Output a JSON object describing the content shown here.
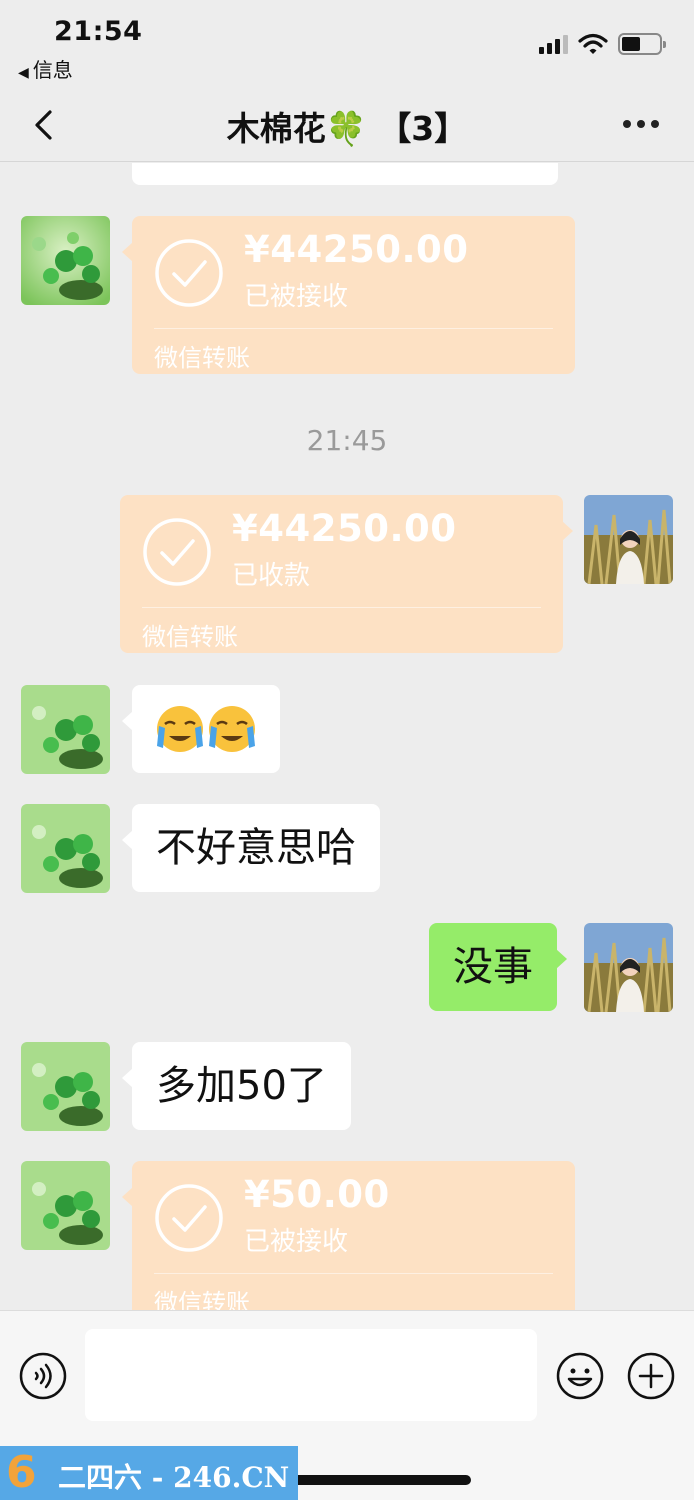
{
  "status_bar": {
    "time": "21:54",
    "back_app": "信息"
  },
  "nav": {
    "title": "木棉花🍀 【3】"
  },
  "chat": {
    "transfer_1": {
      "amount": "¥44250.00",
      "status": "已被接收",
      "label": "微信转账"
    },
    "time_separator": "21:45",
    "transfer_2": {
      "amount": "¥44250.00",
      "status": "已收款",
      "label": "微信转账"
    },
    "message_emoji": "😭😭",
    "message_sorry": "不好意思哈",
    "message_reply": "没事",
    "message_extra": "多加50了",
    "transfer_3": {
      "amount": "¥50.00",
      "status": "已被接收",
      "label": "微信转账"
    }
  },
  "input": {
    "placeholder": ""
  },
  "watermark": {
    "logo": "6",
    "text": "二四六 - 246.CN"
  },
  "colors": {
    "transfer_bg": "#fde1c4",
    "my_bubble": "#95ec69",
    "background": "#ededed"
  },
  "icons": [
    "back-icon",
    "more-icon",
    "voice-icon",
    "emoji-face-icon",
    "plus-icon",
    "check-circle-icon"
  ]
}
